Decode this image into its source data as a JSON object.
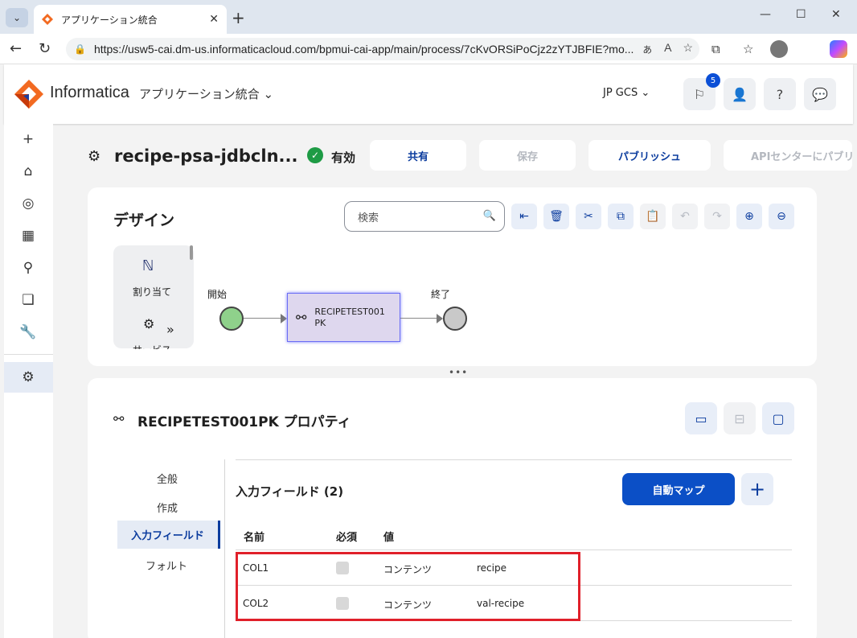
{
  "browser": {
    "tab_title": "アプリケーション統合",
    "url": "https://usw5-cai.dm-us.informaticacloud.com/bpmui-cai-app/main/process/7cKvORSiPoCjz2zYTJBFIE?mo..."
  },
  "header": {
    "brand": "Informatica",
    "app_name": "アプリケーション統合",
    "org": "JP GCS",
    "notification_count": "5"
  },
  "process": {
    "name": "recipe-psa-jdbcln...",
    "status": "有効",
    "buttons": {
      "share": "共有",
      "save": "保存",
      "publish": "パブリッシュ",
      "api_center": "APIセンターにパブリ"
    }
  },
  "design": {
    "title": "デザイン",
    "search_placeholder": "検索",
    "palette": {
      "assign": "割り当て",
      "service": "サービス"
    },
    "flow": {
      "start_label": "開始",
      "end_label": "終了",
      "step_line1": "RECIPETEST001",
      "step_line2": "PK"
    }
  },
  "properties": {
    "title": "RECIPETEST001PK プロパティ",
    "nav": {
      "general": "全般",
      "create": "作成",
      "input_fields": "入力フィールド",
      "fault": "フォルト"
    },
    "input_fields_title": "入力フィールド (2)",
    "auto_map": "自動マップ",
    "columns": {
      "name": "名前",
      "required": "必須",
      "value": "値"
    },
    "rows": [
      {
        "name": "COL1",
        "type": "コンテンツ",
        "value": "recipe"
      },
      {
        "name": "COL2",
        "type": "コンテンツ",
        "value": "val-recipe"
      }
    ]
  }
}
